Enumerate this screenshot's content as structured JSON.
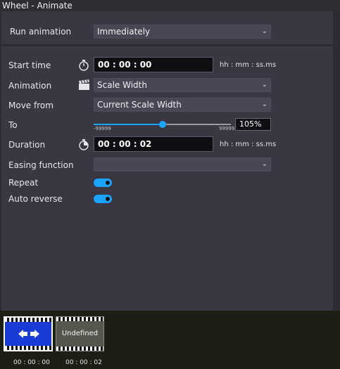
{
  "window": {
    "title": "Wheel - Animate"
  },
  "run_animation": {
    "label": "Run animation",
    "value": "Immediately"
  },
  "start_time": {
    "label": "Start time",
    "value": "00 : 00 : 00",
    "hint": "hh : mm : ss.ms",
    "icon": "stopwatch-icon"
  },
  "animation": {
    "label": "Animation",
    "value": "Scale Width",
    "icon": "clapperboard-icon"
  },
  "move_from": {
    "label": "Move from",
    "value": "Current Scale Width"
  },
  "to": {
    "label": "To",
    "slider_min": "-99999",
    "slider_max": "99999",
    "value": "105%",
    "slider_fraction": 0.5
  },
  "duration": {
    "label": "Duration",
    "value": "00 : 00 : 02",
    "hint": "hh : mm : ss.ms",
    "icon": "stopwatch-icon"
  },
  "easing": {
    "label": "Easing function",
    "value": ""
  },
  "repeat": {
    "label": "Repeat",
    "on": true
  },
  "auto_reverse": {
    "label": "Auto reverse",
    "on": true
  },
  "timeline": {
    "clips": [
      {
        "time": "00 : 00 : 00",
        "label": ""
      },
      {
        "time": "00 : 00 : 02",
        "label": "Undefined"
      }
    ]
  },
  "colors": {
    "accent": "#1aa3ff",
    "panel": "#3a3743",
    "clip_blue": "#1a3bd6"
  }
}
